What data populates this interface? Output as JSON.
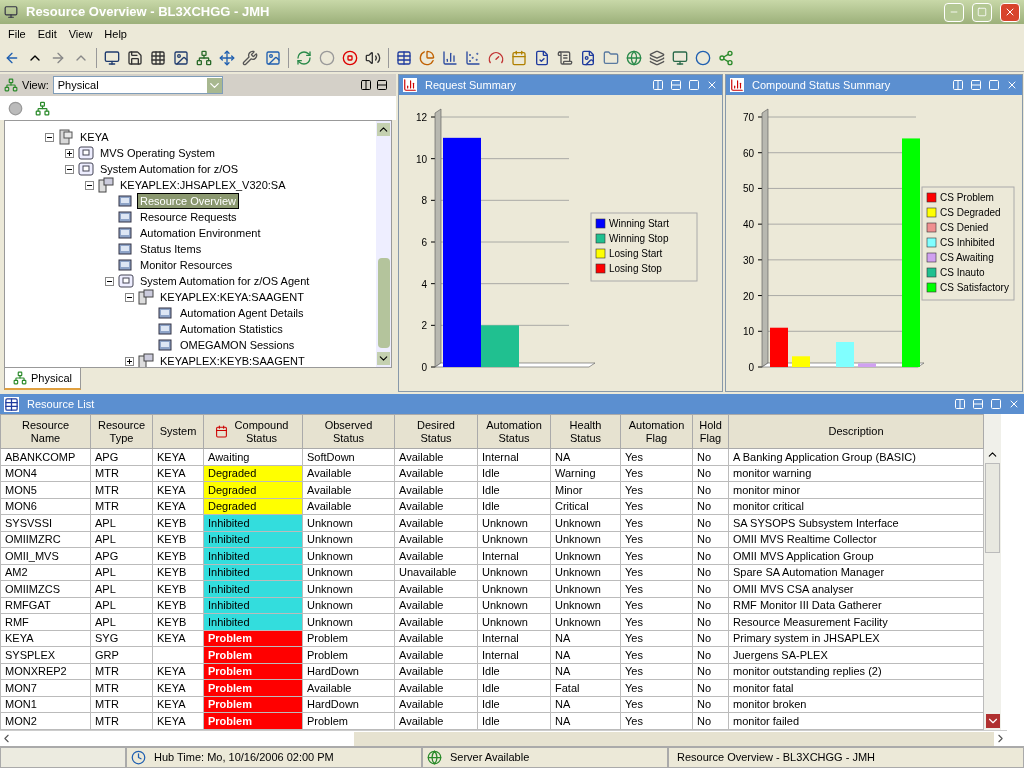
{
  "window": {
    "title": "Resource Overview - BL3XCHGG - JMH"
  },
  "menu": [
    "File",
    "Edit",
    "View",
    "Help"
  ],
  "view_selector": {
    "label": "View:",
    "value": "Physical"
  },
  "tree": [
    {
      "label": "KEYA",
      "kind": "system",
      "expanded": true,
      "selected": false,
      "children": [
        {
          "label": "MVS Operating System",
          "kind": "product",
          "expanded": false,
          "selected": false
        },
        {
          "label": "System Automation for z/OS",
          "kind": "product",
          "expanded": true,
          "selected": false,
          "children": [
            {
              "label": "KEYAPLEX:JHSAPLEX_V320:SA",
              "kind": "server",
              "expanded": true,
              "selected": false,
              "children": [
                {
                  "label": "Resource Overview",
                  "kind": "item",
                  "selected": true
                },
                {
                  "label": "Resource Requests",
                  "kind": "item",
                  "selected": false
                },
                {
                  "label": "Automation Environment",
                  "kind": "item",
                  "selected": false
                },
                {
                  "label": "Status Items",
                  "kind": "item",
                  "selected": false
                },
                {
                  "label": "Monitor Resources",
                  "kind": "item",
                  "selected": false
                },
                {
                  "label": "System Automation for z/OS Agent",
                  "kind": "product",
                  "expanded": true,
                  "selected": false,
                  "children": [
                    {
                      "label": "KEYAPLEX:KEYA:SAAGENT",
                      "kind": "server",
                      "expanded": true,
                      "selected": false,
                      "children": [
                        {
                          "label": "Automation Agent Details",
                          "kind": "item",
                          "selected": false
                        },
                        {
                          "label": "Automation Statistics",
                          "kind": "item",
                          "selected": false
                        },
                        {
                          "label": "OMEGAMON Sessions",
                          "kind": "item",
                          "selected": false
                        }
                      ]
                    },
                    {
                      "label": "KEYAPLEX:KEYB:SAAGENT",
                      "kind": "server",
                      "expanded": false,
                      "selected": false
                    }
                  ]
                }
              ]
            }
          ]
        }
      ]
    }
  ],
  "tabs": [
    {
      "label": "Physical",
      "selected": true
    }
  ],
  "charts": [
    {
      "title": "Request Summary",
      "chart_data": {
        "type": "bar",
        "grid": true,
        "legend": "right",
        "ylim": [
          0,
          12
        ],
        "yticks": [
          0,
          2,
          4,
          6,
          8,
          10,
          12
        ],
        "series": [
          {
            "name": "Winning Start",
            "color": "#0000ff",
            "values": [
              11,
              null,
              null,
              null
            ]
          },
          {
            "name": "Winning Stop",
            "color": "#20c090",
            "values": [
              null,
              2,
              null,
              null
            ]
          },
          {
            "name": "Losing Start",
            "color": "#ffff00",
            "values": [
              null,
              null,
              0,
              null
            ]
          },
          {
            "name": "Losing Stop",
            "color": "#ff0000",
            "values": [
              null,
              null,
              null,
              0
            ]
          }
        ]
      }
    },
    {
      "title": "Compound Status Summary",
      "chart_data": {
        "type": "bar",
        "grid": true,
        "legend": "right",
        "ylim": [
          0,
          70
        ],
        "yticks": [
          0,
          10,
          20,
          30,
          40,
          50,
          60,
          70
        ],
        "series": [
          {
            "name": "CS Problem",
            "color": "#ff0000",
            "values": [
              11,
              null,
              null,
              null,
              null,
              null,
              null
            ]
          },
          {
            "name": "CS Degraded",
            "color": "#ffff00",
            "values": [
              null,
              3,
              null,
              null,
              null,
              null,
              null
            ]
          },
          {
            "name": "CS Denied",
            "color": "#f09090",
            "values": [
              null,
              null,
              0,
              null,
              null,
              null,
              null
            ]
          },
          {
            "name": "CS Inhibited",
            "color": "#80ffff",
            "values": [
              null,
              null,
              null,
              7,
              null,
              null,
              null
            ]
          },
          {
            "name": "CS Awaiting",
            "color": "#d0a0f0",
            "values": [
              null,
              null,
              null,
              null,
              1,
              null,
              null
            ]
          },
          {
            "name": "CS Inauto",
            "color": "#20c090",
            "values": [
              null,
              null,
              null,
              null,
              null,
              0,
              null
            ]
          },
          {
            "name": "CS Satisfactory",
            "color": "#00ff00",
            "values": [
              null,
              null,
              null,
              null,
              null,
              null,
              64
            ]
          }
        ]
      }
    }
  ],
  "resource_list": {
    "title": "Resource List",
    "columns": [
      "Resource Name",
      "Resource Type",
      "System",
      "Compound Status",
      "Observed Status",
      "Desired Status",
      "Automation Status",
      "Health Status",
      "Automation Flag",
      "Hold Flag",
      "Description"
    ],
    "rows": [
      {
        "cells": [
          "ABANKCOMP",
          "APG",
          "KEYA",
          "Awaiting",
          "SoftDown",
          "Available",
          "Internal",
          "NA",
          "Yes",
          "No",
          "A Banking Application Group (BASIC)"
        ],
        "color": "#ffffff"
      },
      {
        "cells": [
          "MON4",
          "MTR",
          "KEYA",
          "Degraded",
          "Available",
          "Available",
          "Idle",
          "Warning",
          "Yes",
          "No",
          "monitor warning"
        ],
        "color": "#ffff00"
      },
      {
        "cells": [
          "MON5",
          "MTR",
          "KEYA",
          "Degraded",
          "Available",
          "Available",
          "Idle",
          "Minor",
          "Yes",
          "No",
          "monitor minor"
        ],
        "color": "#ffff00"
      },
      {
        "cells": [
          "MON6",
          "MTR",
          "KEYA",
          "Degraded",
          "Available",
          "Available",
          "Idle",
          "Critical",
          "Yes",
          "No",
          "monitor critical"
        ],
        "color": "#ffff00"
      },
      {
        "cells": [
          "SYSVSSI",
          "APL",
          "KEYB",
          "Inhibited",
          "Unknown",
          "Available",
          "Unknown",
          "Unknown",
          "Yes",
          "No",
          "SA SYSOPS Subsystem Interface"
        ],
        "color": "#33dddd"
      },
      {
        "cells": [
          "OMIIMZRC",
          "APL",
          "KEYB",
          "Inhibited",
          "Unknown",
          "Available",
          "Unknown",
          "Unknown",
          "Yes",
          "No",
          "OMII MVS Realtime Collector"
        ],
        "color": "#33dddd"
      },
      {
        "cells": [
          "OMII_MVS",
          "APG",
          "KEYB",
          "Inhibited",
          "Unknown",
          "Available",
          "Internal",
          "Unknown",
          "Yes",
          "No",
          "OMII MVS Application Group"
        ],
        "color": "#33dddd"
      },
      {
        "cells": [
          "AM2",
          "APL",
          "KEYB",
          "Inhibited",
          "Unknown",
          "Unavailable",
          "Unknown",
          "Unknown",
          "Yes",
          "No",
          "Spare SA Automation Manager"
        ],
        "color": "#33dddd"
      },
      {
        "cells": [
          "OMIIMZCS",
          "APL",
          "KEYB",
          "Inhibited",
          "Unknown",
          "Available",
          "Unknown",
          "Unknown",
          "Yes",
          "No",
          "OMII MVS CSA analyser"
        ],
        "color": "#33dddd"
      },
      {
        "cells": [
          "RMFGAT",
          "APL",
          "KEYB",
          "Inhibited",
          "Unknown",
          "Available",
          "Unknown",
          "Unknown",
          "Yes",
          "No",
          "RMF Monitor III Data Gatherer"
        ],
        "color": "#33dddd"
      },
      {
        "cells": [
          "RMF",
          "APL",
          "KEYB",
          "Inhibited",
          "Unknown",
          "Available",
          "Unknown",
          "Unknown",
          "Yes",
          "No",
          "Resource Measurement Facility"
        ],
        "color": "#33dddd"
      },
      {
        "cells": [
          "KEYA",
          "SYG",
          "KEYA",
          "Problem",
          "Problem",
          "Available",
          "Internal",
          "NA",
          "Yes",
          "No",
          "Primary system in JHSAPLEX"
        ],
        "color": "#ff0000"
      },
      {
        "cells": [
          "SYSPLEX",
          "GRP",
          "",
          "Problem",
          "Problem",
          "Available",
          "Internal",
          "NA",
          "Yes",
          "No",
          "Juergens SA-PLEX"
        ],
        "color": "#ff0000"
      },
      {
        "cells": [
          "MONXREP2",
          "MTR",
          "KEYA",
          "Problem",
          "HardDown",
          "Available",
          "Idle",
          "NA",
          "Yes",
          "No",
          "monitor outstanding replies (2)"
        ],
        "color": "#ff0000"
      },
      {
        "cells": [
          "MON7",
          "MTR",
          "KEYA",
          "Problem",
          "Available",
          "Available",
          "Idle",
          "Fatal",
          "Yes",
          "No",
          "monitor fatal"
        ],
        "color": "#ff0000"
      },
      {
        "cells": [
          "MON1",
          "MTR",
          "KEYA",
          "Problem",
          "HardDown",
          "Available",
          "Idle",
          "NA",
          "Yes",
          "No",
          "monitor broken"
        ],
        "color": "#ff0000"
      },
      {
        "cells": [
          "MON2",
          "MTR",
          "KEYA",
          "Problem",
          "Problem",
          "Available",
          "Idle",
          "NA",
          "Yes",
          "No",
          "monitor failed"
        ],
        "color": "#ff0000"
      }
    ]
  },
  "status_bar": [
    "Hub Time: Mo, 10/16/2006 02:00 PM",
    "Server Available",
    "Resource Overview - BL3XCHGG - JMH"
  ]
}
